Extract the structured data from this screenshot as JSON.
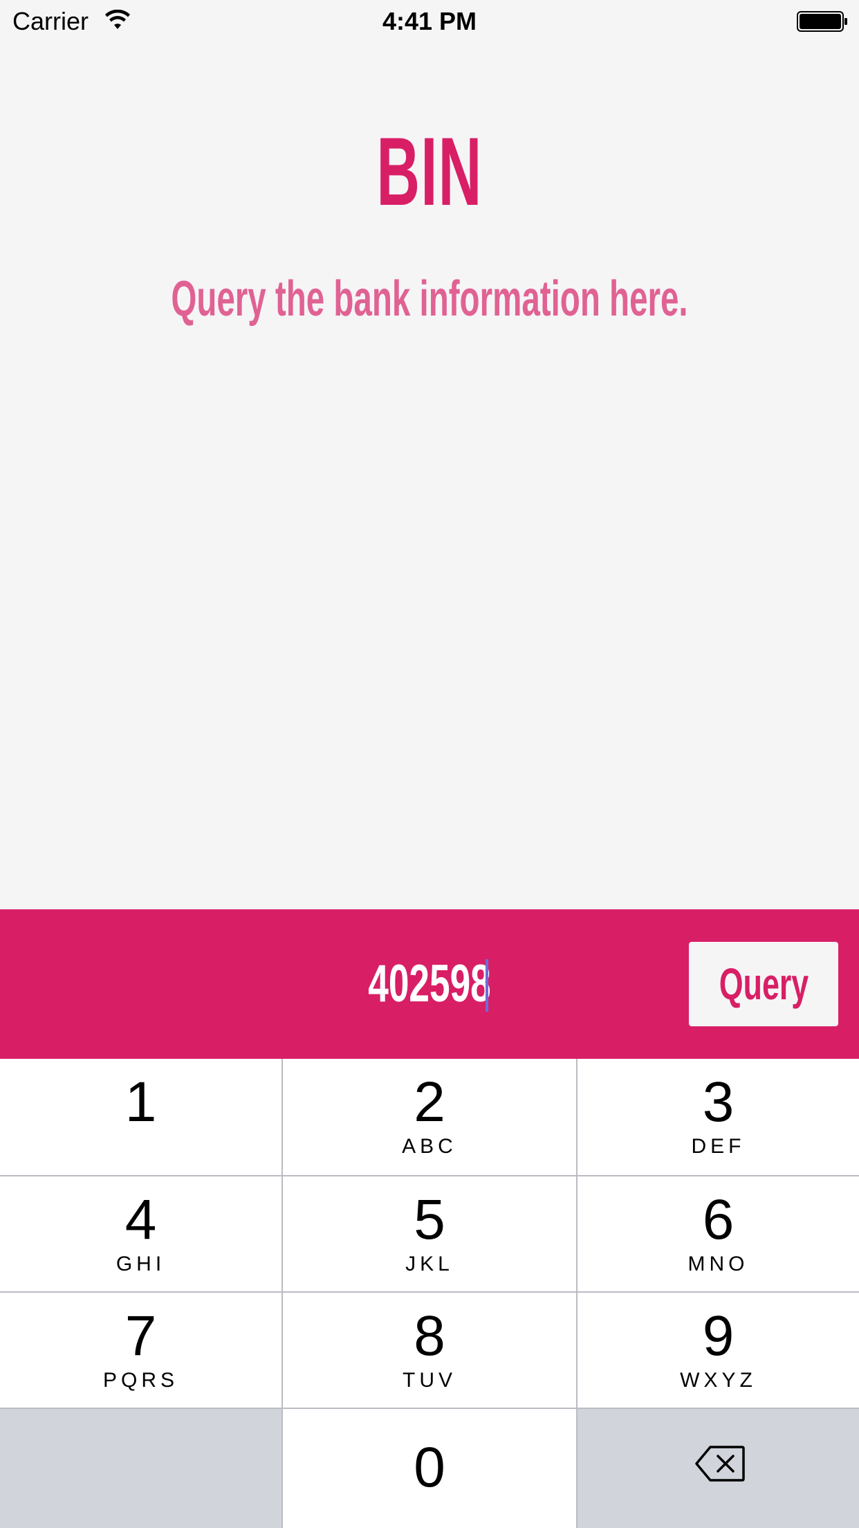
{
  "status_bar": {
    "carrier": "Carrier",
    "time": "4:41 PM",
    "wifi_icon": "wifi-icon",
    "battery_icon": "battery-full-icon"
  },
  "header": {
    "title": "BIN",
    "subtitle": "Query the bank information here."
  },
  "query": {
    "input_value": "402598",
    "button_label": "Query"
  },
  "colors": {
    "accent": "#d81f66",
    "subtitle": "#e06293",
    "background": "#f5f5f6",
    "cursor": "#6d6bd8",
    "keypad_dark": "#d1d4da"
  },
  "keypad": {
    "keys": [
      {
        "digit": "1",
        "letters": ""
      },
      {
        "digit": "2",
        "letters": "ABC"
      },
      {
        "digit": "3",
        "letters": "DEF"
      },
      {
        "digit": "4",
        "letters": "GHI"
      },
      {
        "digit": "5",
        "letters": "JKL"
      },
      {
        "digit": "6",
        "letters": "MNO"
      },
      {
        "digit": "7",
        "letters": "PQRS"
      },
      {
        "digit": "8",
        "letters": "TUV"
      },
      {
        "digit": "9",
        "letters": "WXYZ"
      },
      {
        "digit": "0",
        "letters": ""
      }
    ],
    "delete_icon": "backspace-icon"
  }
}
